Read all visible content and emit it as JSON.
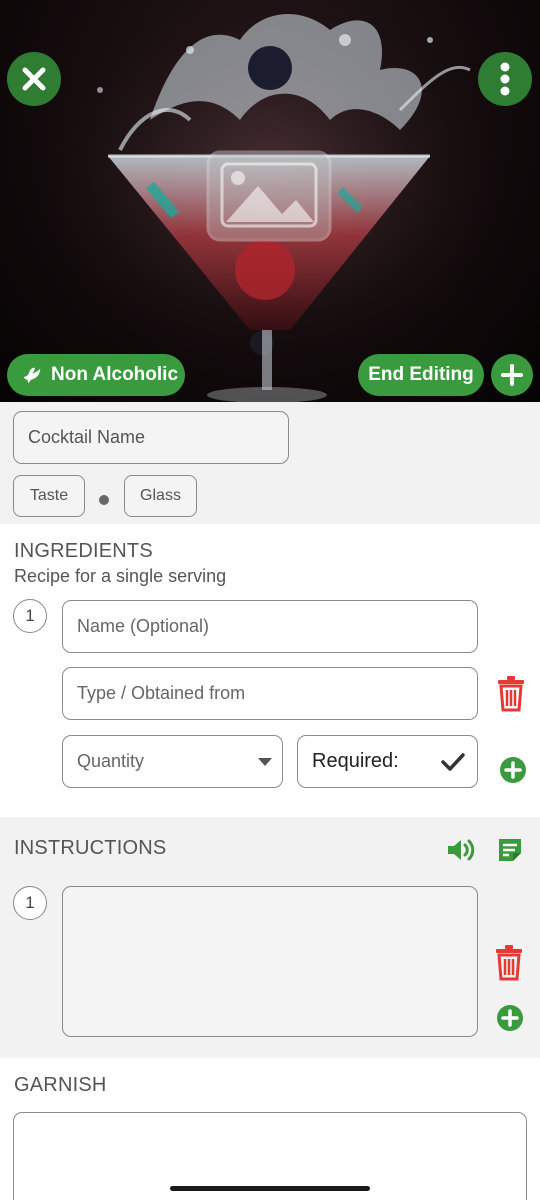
{
  "hero": {
    "category_label": "Non Alcoholic",
    "end_editing_label": "End Editing"
  },
  "name_section": {
    "name_placeholder": "Cocktail Name",
    "taste_label": "Taste",
    "glass_label": "Glass"
  },
  "ingredients": {
    "title": "INGREDIENTS",
    "subtitle": "Recipe for a single serving",
    "items": [
      {
        "number": "1",
        "name_placeholder": "Name (Optional)",
        "type_placeholder": "Type / Obtained from",
        "quantity_placeholder": "Quantity",
        "required_label": "Required:"
      }
    ]
  },
  "instructions": {
    "title": "INSTRUCTIONS",
    "steps": [
      {
        "number": "1",
        "text": ""
      }
    ]
  },
  "garnish": {
    "title": "GARNISH",
    "text": ""
  },
  "colors": {
    "accent_green": "#3a9a3e",
    "dark_green": "#2f7d32",
    "delete_red": "#e53935"
  },
  "icons": [
    "close-icon",
    "more-vert-icon",
    "dove-icon",
    "plus-icon",
    "image-placeholder-icon",
    "chevron-down-icon",
    "checkmark-icon",
    "trash-icon",
    "add-circle-icon",
    "speaker-icon",
    "note-icon"
  ]
}
